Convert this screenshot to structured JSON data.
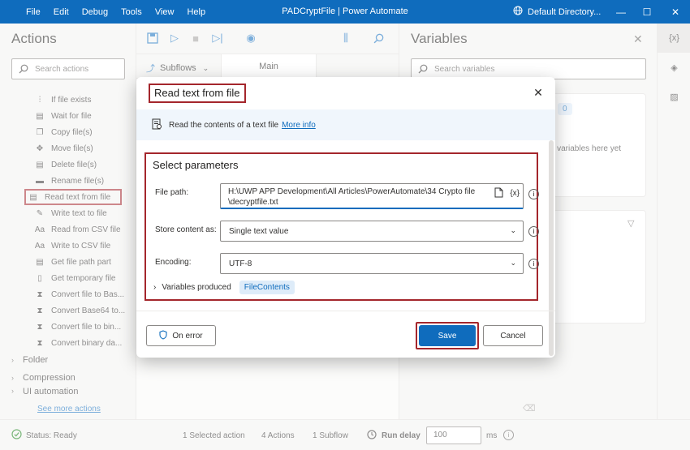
{
  "menu": [
    "File",
    "Edit",
    "Debug",
    "Tools",
    "View",
    "Help"
  ],
  "window_title": "PADCryptFile | Power Automate",
  "environment": "Default Directory...",
  "actions_panel": {
    "title": "Actions",
    "search_placeholder": "Search actions",
    "items": [
      {
        "label": "If file exists",
        "icon": "file-branch-icon"
      },
      {
        "label": "Wait for file",
        "icon": "file-wait-icon"
      },
      {
        "label": "Copy file(s)",
        "icon": "file-copy-icon"
      },
      {
        "label": "Move file(s)",
        "icon": "file-move-icon"
      },
      {
        "label": "Delete file(s)",
        "icon": "file-delete-icon"
      },
      {
        "label": "Rename file(s)",
        "icon": "file-rename-icon"
      },
      {
        "label": "Read text from file",
        "icon": "file-read-icon"
      },
      {
        "label": "Write text to file",
        "icon": "file-write-icon"
      },
      {
        "label": "Read from CSV file",
        "icon": "csv-read-icon"
      },
      {
        "label": "Write to CSV file",
        "icon": "csv-write-icon"
      },
      {
        "label": "Get file path part",
        "icon": "file-path-icon"
      },
      {
        "label": "Get temporary file",
        "icon": "temp-file-icon"
      },
      {
        "label": "Convert file to Bas...",
        "icon": "convert-icon"
      },
      {
        "label": "Convert Base64 to...",
        "icon": "convert-icon"
      },
      {
        "label": "Convert file to bin...",
        "icon": "convert-icon"
      },
      {
        "label": "Convert binary da...",
        "icon": "convert-icon"
      }
    ],
    "groups": [
      "Folder",
      "Compression",
      "UI automation"
    ],
    "see_more": "See more actions"
  },
  "subflows": {
    "label": "Subflows",
    "main_tab": "Main"
  },
  "variables_panel": {
    "title": "Variables",
    "search_placeholder": "Search variables",
    "badge": "0",
    "empty_text": "ut variables here yet"
  },
  "statusbar": {
    "status": "Status: Ready",
    "selected": "1 Selected action",
    "actions": "4 Actions",
    "subflow": "1 Subflow",
    "run_delay_label": "Run delay",
    "run_delay_value": "100",
    "unit": "ms"
  },
  "dialog": {
    "title": "Read text from file",
    "description": "Read the contents of a text file",
    "more_info": "More info",
    "section_title": "Select parameters",
    "file_path_label": "File path:",
    "file_path_line1": "H:\\UWP APP Development\\All Articles\\PowerAutomate\\34 Crypto file",
    "file_path_line2": "\\decryptfile.txt",
    "var_button": "{x}",
    "store_label": "Store content as:",
    "store_value": "Single text value",
    "encoding_label": "Encoding:",
    "encoding_value": "UTF-8",
    "variables_produced_label": "Variables produced",
    "variable_chip": "FileContents",
    "on_error": "On error",
    "save": "Save",
    "cancel": "Cancel"
  },
  "colors": {
    "accent": "#0f6cbd",
    "highlight": "#a4262c"
  }
}
